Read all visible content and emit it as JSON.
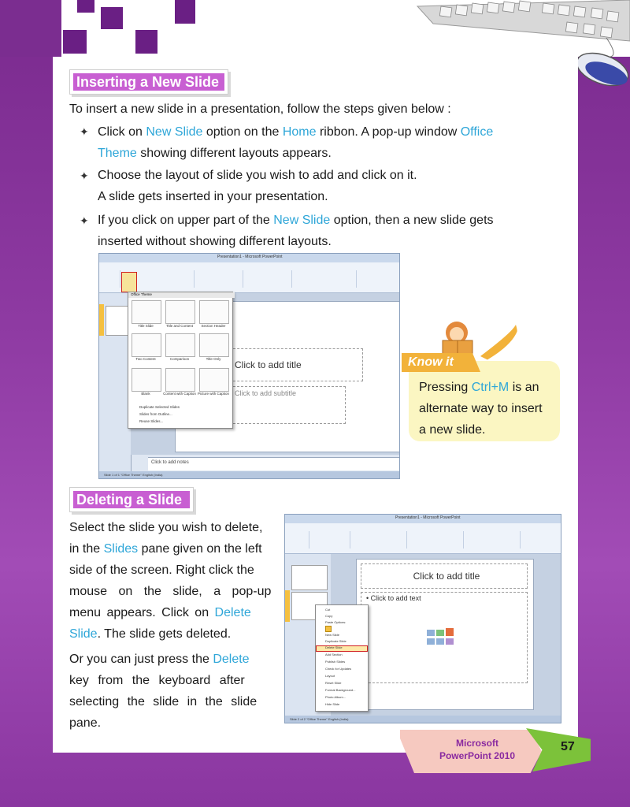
{
  "section1": {
    "heading": "Inserting a New Slide",
    "intro": "To insert a new slide in a presentation, follow the steps given below :",
    "bullet1": {
      "p1": "Click on ",
      "h1": "New Slide",
      "p2": " option on the ",
      "h2": "Home",
      "p3": " ribbon. A pop-up window ",
      "h3a": "Office",
      "h3b": "Theme",
      "p4": " showing different layouts appears."
    },
    "bullet2": {
      "line1": "Choose the layout of slide you wish to add and click on it.",
      "line2": "A slide gets inserted in your presentation."
    },
    "bullet3": {
      "p1": "If you click on upper part of the ",
      "h1": "New Slide",
      "p2": " option, then a new slide gets",
      "line2": "inserted without showing different layouts."
    },
    "bullet_symbol": "✦"
  },
  "screenshot1": {
    "window_title": "Presentation1 - Microsoft PowerPoint",
    "tabs": [
      "File",
      "Home",
      "Insert",
      "Design",
      "Transitions",
      "Animations",
      "Slide Show",
      "Review",
      "View"
    ],
    "popup_title": "Office Theme",
    "layouts": [
      "Title Slide",
      "Title and Content",
      "Section Header",
      "Two Content",
      "Comparison",
      "Title Only",
      "Blank",
      "Content with Caption",
      "Picture with Caption"
    ],
    "menu_items": [
      "Duplicate Selected Slides",
      "Slides from Outline...",
      "Reuse Slides..."
    ],
    "title_placeholder": "Click to add title",
    "subtitle_placeholder": "Click to add subtitle",
    "notes_placeholder": "Click to add notes",
    "status_text": "Slide 1 of 1   \"Office Theme\"   English (India)"
  },
  "know_it": {
    "tag": "Know it",
    "p1": "Pressing ",
    "h1": "Ctrl+M",
    "p2": " is an",
    "line2": "alternate way to insert",
    "line3": "a new slide."
  },
  "section2": {
    "heading": "Deleting a Slide",
    "para1": {
      "l1": "Select the slide you wish to delete,",
      "l2a": "in the ",
      "l2h": "Slides",
      "l2b": " pane given on the left",
      "l3": "side of the screen. Right click the",
      "l4": "mouse on the slide, a pop-up",
      "l5a": "menu appears. Click on ",
      "l5h": "Delete",
      "l6h": "Slide",
      "l6b": ". The slide gets deleted."
    },
    "para2": {
      "l1a": "Or you can just press the ",
      "l1h": "Delete",
      "l2": "key from the keyboard after",
      "l3": "selecting the slide in the slide",
      "l4": "pane."
    }
  },
  "screenshot2": {
    "window_title": "Presentation1 - Microsoft PowerPoint",
    "title_placeholder": "Click to add title",
    "text_placeholder": "Click to add text",
    "context_menu": [
      "Cut",
      "Copy",
      "Paste Options:",
      "New Slide",
      "Duplicate Slide",
      "Delete Slide",
      "Add Section",
      "Publish Slides",
      "Check for Updates",
      "Layout",
      "Reset Slide",
      "Format Background...",
      "Photo Album...",
      "Hide Slide"
    ],
    "status_text": "Slide 2 of 2   \"Office Theme\"   English (India)"
  },
  "footer": {
    "line1": "Microsoft",
    "line2": "PowerPoint 2010",
    "page_number": "57"
  },
  "colors": {
    "accent_blue": "#2ea6d8",
    "heading_purple": "#c85fd2",
    "background_purple": "#8e3aa2",
    "know_yellow": "#f2b23a"
  }
}
